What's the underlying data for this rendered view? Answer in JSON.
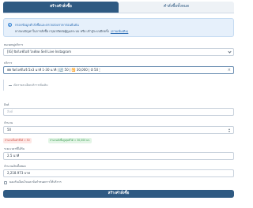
{
  "tabs": [
    {
      "label": "สร้างคำสั่งซื้อ",
      "active": true
    },
    {
      "label": "คำสั่งซื้อทั้งหมด",
      "active": false
    }
  ],
  "info": {
    "line1": "กรอกข้อมูลคำสั่งซื้อและตรวจสอบราคาก่อนยืนยัน",
    "line2": "หากพบปัญหาในการสั่งซื้อ กรุณาติดต่อผู้ดูแลระบบ หรือ เข้าสู่ระบบอีกครั้ง",
    "link": "(อ่านเพิ่มเติม)"
  },
  "category": {
    "label": "หมวดหมู่บริการ",
    "value": "[IG] ปิดไลฟ์ไอจี ไลฟ์สด Sell Live Instagram"
  },
  "service": {
    "label": "บริการ",
    "value": "🎟 ปิดไลฟ์ไอจี 5x3 นาที 1-30 นาที | 🔄 50 | 🔁 30,000 | ⏱ 50 🕯"
  },
  "note": "เปิดรายละเอียดบริการเพิ่มเติม",
  "link_field": {
    "label": "ลิงค์",
    "placeholder": "ลิงค์"
  },
  "quantity": {
    "label": "จำนวน",
    "value": "50"
  },
  "badges": {
    "min": "จำนวนขั้นต่ำที่ได้ = 50",
    "max": "จำนวนสั่งซื้อสูงสุดที่ได้ = 30,000 มก.",
    "colors": {
      "red": "#c9473a",
      "green": "#3a9a4f"
    }
  },
  "duration": {
    "label": "ระยะเวลาที่ได้รับ",
    "value": "2.5 นาที"
  },
  "total": {
    "label": "จำนวนเงินทั้งหมด",
    "value": "2,218.973 บาท"
  },
  "agree": {
    "label": "ยอมรับเงื่อนไขและข้อกำหนดการให้บริการ"
  },
  "submit_label": "สร้างคำสั่งซื้อ",
  "colors": {
    "primary": "#2f5a82",
    "info_bg": "#e6f0fb",
    "border": "#c8d1dc"
  }
}
